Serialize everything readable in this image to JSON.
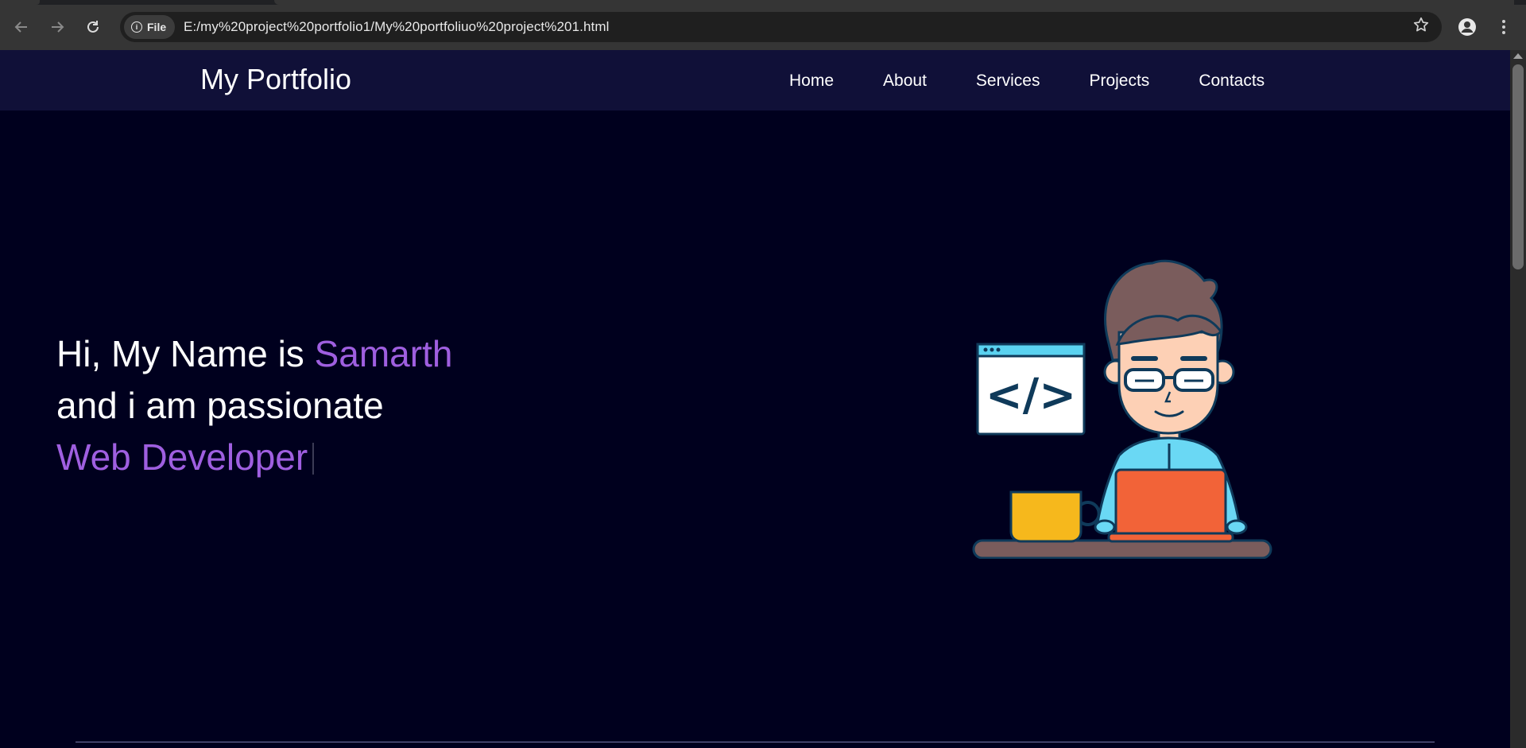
{
  "browser": {
    "site_chip_label": "File",
    "url": "E:/my%20project%20portfolio1/My%20portfoliuo%20project%201.html",
    "back_icon": "arrow-left-icon",
    "forward_icon": "arrow-right-icon",
    "reload_icon": "reload-icon",
    "bookmark_icon": "star-icon",
    "profile_icon": "person-icon",
    "menu_icon": "kebab-menu-icon"
  },
  "navbar": {
    "brand": "My Portfolio",
    "links": [
      "Home",
      "About",
      "Services",
      "Projects",
      "Contacts"
    ]
  },
  "hero": {
    "line1_prefix": "Hi, My Name is ",
    "name": "Samarth",
    "line2": "and i am passionate",
    "role": "Web Developer"
  },
  "illustration": {
    "code_symbol": "</>"
  },
  "colors": {
    "background": "#00001e",
    "navbar": "#101038",
    "accent": "#9f5fe0"
  }
}
